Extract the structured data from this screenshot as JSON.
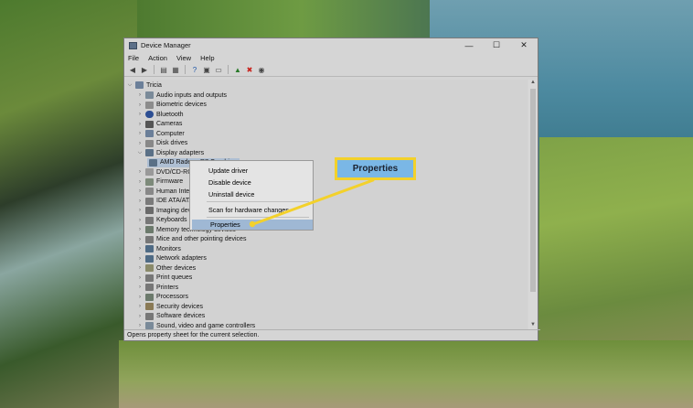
{
  "window": {
    "title": "Device Manager",
    "controls": {
      "minimize": "—",
      "maximize": "☐",
      "close": "✕"
    }
  },
  "menubar": [
    "File",
    "Action",
    "View",
    "Help"
  ],
  "tree": {
    "root": "Tricia",
    "items": [
      "Audio inputs and outputs",
      "Biometric devices",
      "Bluetooth",
      "Cameras",
      "Computer",
      "Disk drives",
      "Display adapters",
      "AMD Radeon R7 Graphics",
      "DVD/CD-ROM drives",
      "Firmware",
      "Human Interface Devices",
      "IDE ATA/ATAPI controllers",
      "Imaging devices",
      "Keyboards",
      "Memory technology devices",
      "Mice and other pointing devices",
      "Monitors",
      "Network adapters",
      "Other devices",
      "Print queues",
      "Printers",
      "Processors",
      "Security devices",
      "Software devices",
      "Sound, video and game controllers"
    ]
  },
  "context_menu": {
    "items": [
      "Update driver",
      "Disable device",
      "Uninstall device",
      "Scan for hardware changes",
      "Properties"
    ]
  },
  "status_text": "Opens property sheet for the current selection.",
  "callout": {
    "label": "Properties"
  },
  "colors": {
    "callout_border": "#f3d12b",
    "callout_fill": "#7ab7e6",
    "highlight": "#9fb8d4"
  }
}
